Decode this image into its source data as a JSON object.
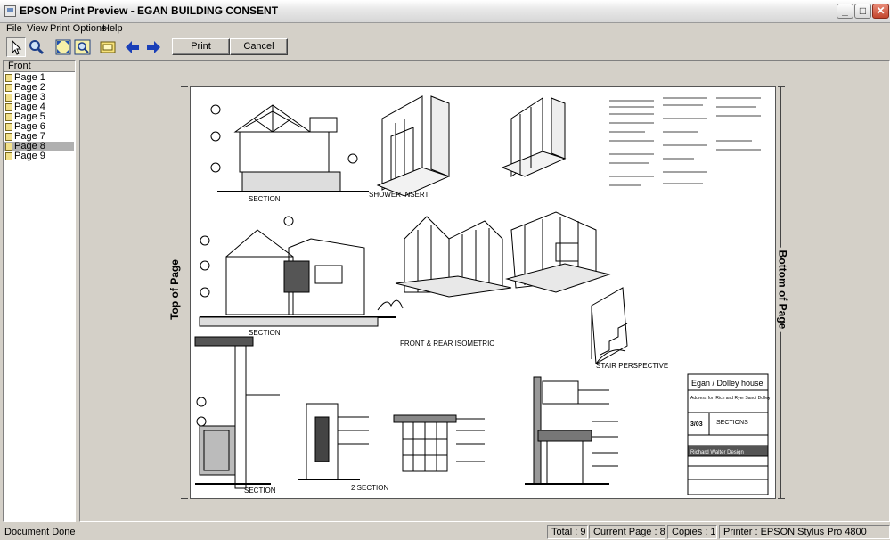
{
  "window": {
    "title": "EPSON Print Preview - EGAN BUILDING CONSENT",
    "minimize_symbol": "_",
    "maximize_symbol": "□",
    "close_symbol": "✕"
  },
  "menu": [
    "File",
    "View",
    "Print Options",
    "Help"
  ],
  "toolbar": {
    "tools": [
      "pointer-icon",
      "zoom-icon",
      "fit-page-icon",
      "zoom-page-icon",
      "page-frame-icon",
      "prev-page-icon",
      "next-page-icon"
    ],
    "print_label": "Print",
    "cancel_label": "Cancel"
  },
  "sidebar": {
    "tab": "Front",
    "pages": [
      "Page 1",
      "Page 2",
      "Page 3",
      "Page 4",
      "Page 5",
      "Page 6",
      "Page 7",
      "Page 8",
      "Page 9"
    ],
    "selected_index": 7
  },
  "preview": {
    "top_label": "Top of Page",
    "bottom_label": "Bottom of Page",
    "drawing_labels": {
      "section_a": "SECTION",
      "section_b": "SECTION",
      "section_c": "SECTION",
      "section_d": "2 SECTION",
      "shower_insert": "SHOWER INSERT",
      "front_rear": "FRONT & REAR ISOMETRIC",
      "stair": "STAIR PERSPECTIVE",
      "title_block_project": "Egan / Dolley house",
      "title_block_client": "Address for: Rich and Ryer Sandi Dolley",
      "title_block_sheet": "3/03",
      "title_block_content": "SECTIONS",
      "title_block_designer": "Richard Walter Design"
    }
  },
  "status": {
    "message": "Document Done",
    "total": "Total : 9",
    "current_page": "Current Page : 8",
    "copies": "Copies : 1",
    "printer": "Printer : EPSON Stylus Pro 4800"
  }
}
